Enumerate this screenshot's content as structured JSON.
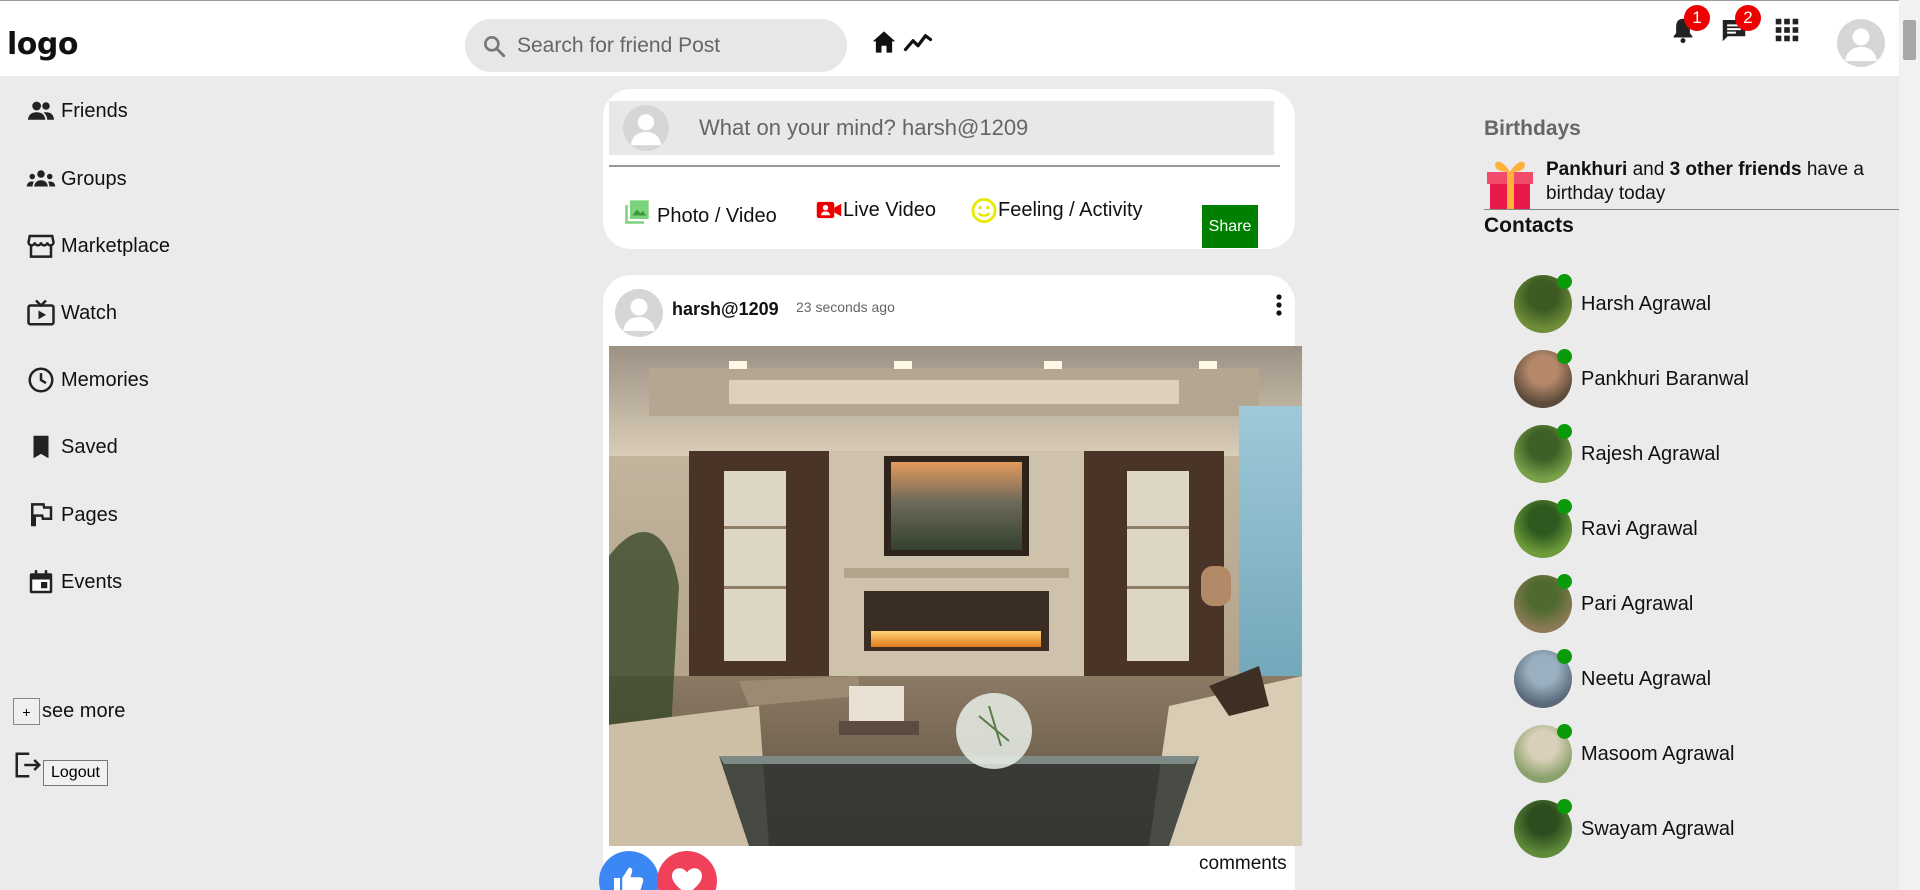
{
  "header": {
    "logo": "logo",
    "search_placeholder": "Search for friend Post",
    "notifications_count": "1",
    "messages_count": "2"
  },
  "sidebar": {
    "items": [
      {
        "label": "Friends",
        "icon": "people-icon"
      },
      {
        "label": "Groups",
        "icon": "groups-icon"
      },
      {
        "label": "Marketplace",
        "icon": "storefront-icon"
      },
      {
        "label": "Watch",
        "icon": "live-tv-icon"
      },
      {
        "label": "Memories",
        "icon": "clock-icon"
      },
      {
        "label": "Saved",
        "icon": "bookmark-icon"
      },
      {
        "label": "Pages",
        "icon": "flag-icon"
      },
      {
        "label": "Events",
        "icon": "calendar-icon"
      }
    ],
    "see_more_button": "+",
    "see_more_label": "see more",
    "logout_label": "Logout"
  },
  "composer": {
    "placeholder": "What on your mind? harsh@1209",
    "photo_label": "Photo / Video",
    "live_label": "Live Video",
    "feeling_label": "Feeling / Activity",
    "share_label": "Share"
  },
  "post": {
    "username": "harsh@1209",
    "time": "23 seconds ago",
    "comments_label": "comments"
  },
  "rightbar": {
    "birthdays_title": "Birthdays",
    "bday_name": "Pankhuri",
    "bday_and": " and ",
    "bday_others": "3 other friends",
    "bday_suffix": " have a birthday today",
    "contacts_title": "Contacts",
    "contacts": [
      "Harsh Agrawal",
      "Pankhuri Baranwal",
      "Rajesh Agrawal",
      "Ravi Agrawal",
      "Pari Agrawal",
      "Neetu Agrawal",
      "Masoom Agrawal",
      "Swayam Agrawal"
    ]
  },
  "colors": {
    "accent_green": "#008000",
    "online_dot": "#0a9a0a",
    "badge_red": "#e00000",
    "like_blue": "#3b88f5",
    "love_red": "#f0405a"
  }
}
